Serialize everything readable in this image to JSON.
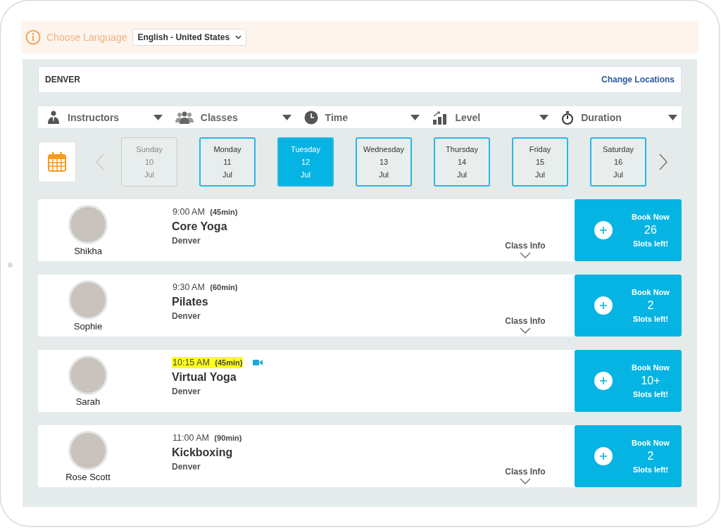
{
  "language_bar": {
    "label": "Choose Language",
    "value": "English - United States"
  },
  "location": {
    "name": "DENVER",
    "link": "Change Locations"
  },
  "filters": [
    {
      "kind": "instructor",
      "label": "Instructors"
    },
    {
      "kind": "classes",
      "label": "Classes"
    },
    {
      "kind": "time",
      "label": "Time"
    },
    {
      "kind": "level",
      "label": "Level"
    },
    {
      "kind": "duration",
      "label": "Duration"
    }
  ],
  "days": [
    {
      "day": "Sunday",
      "date": "10",
      "month": "Jul",
      "selected": false,
      "disabled": true
    },
    {
      "day": "Monday",
      "date": "11",
      "month": "Jul",
      "selected": false,
      "disabled": false
    },
    {
      "day": "Tuesday",
      "date": "12",
      "month": "Jul",
      "selected": true,
      "disabled": false
    },
    {
      "day": "Wednesday",
      "date": "13",
      "month": "Jul",
      "selected": false,
      "disabled": false
    },
    {
      "day": "Thursday",
      "date": "14",
      "month": "Jul",
      "selected": false,
      "disabled": false
    },
    {
      "day": "Friday",
      "date": "15",
      "month": "Jul",
      "selected": false,
      "disabled": false
    },
    {
      "day": "Saturday",
      "date": "16",
      "month": "Jul",
      "selected": false,
      "disabled": false
    }
  ],
  "classes": [
    {
      "instructor": "Shikha",
      "time": "9:00 AM",
      "duration": "(45min)",
      "name": "Core Yoga",
      "location": "Denver",
      "highlighted": false,
      "virtual": false,
      "info": "Class Info",
      "book": "Book Now",
      "slots": "26",
      "slots_label": "Slots left!"
    },
    {
      "instructor": "Sophie",
      "time": "9:30 AM",
      "duration": "(60min)",
      "name": "Pilates",
      "location": "Denver",
      "highlighted": false,
      "virtual": false,
      "info": "Class Info",
      "book": "Book Now",
      "slots": "2",
      "slots_label": "Slots left!"
    },
    {
      "instructor": "Sarah",
      "time": "10:15 AM",
      "duration": "(45min)",
      "name": "Virtual Yoga",
      "location": "Denver",
      "highlighted": true,
      "virtual": true,
      "book": "Book Now",
      "slots": "10+",
      "slots_label": "Slots left!"
    },
    {
      "instructor": "Rose Scott",
      "time": "11:00 AM",
      "duration": "(90min)",
      "name": "Kickboxing",
      "location": "Denver",
      "highlighted": false,
      "virtual": false,
      "info": "Class Info",
      "book": "Book Now",
      "slots": "2",
      "slots_label": "Slots left!"
    }
  ]
}
